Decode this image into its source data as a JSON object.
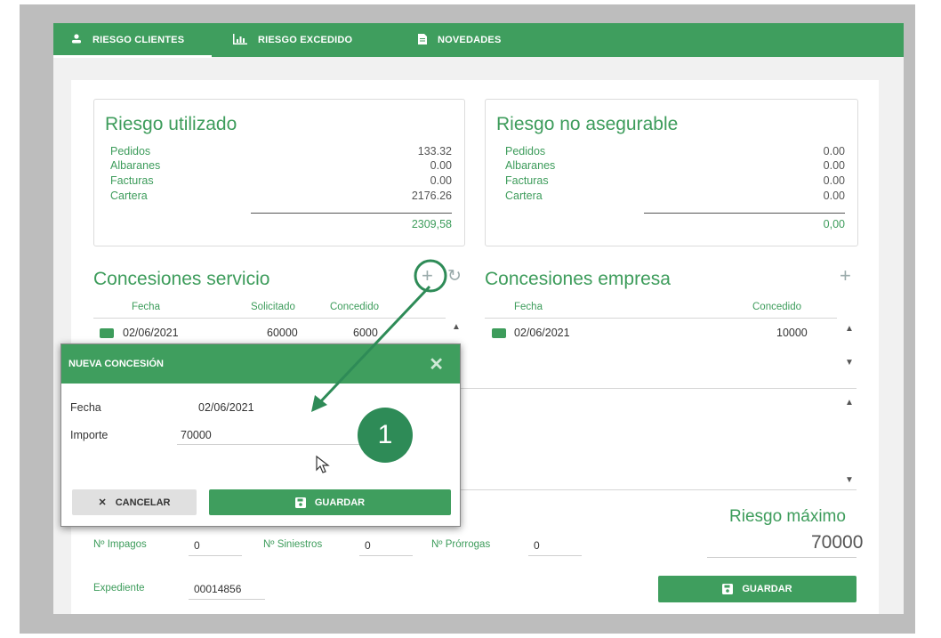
{
  "tabs": [
    {
      "label": "RIESGO CLIENTES",
      "icon": "user-icon",
      "active": true
    },
    {
      "label": "RIESGO EXCEDIDO",
      "icon": "bar-chart-icon",
      "active": false
    },
    {
      "label": "NOVEDADES",
      "icon": "document-icon",
      "active": false
    }
  ],
  "riesgo_utilizado": {
    "title": "Riesgo utilizado",
    "rows": [
      {
        "label": "Pedidos",
        "value": "133.32"
      },
      {
        "label": "Albaranes",
        "value": "0.00"
      },
      {
        "label": "Facturas",
        "value": "0.00"
      },
      {
        "label": "Cartera",
        "value": "2176.26"
      }
    ],
    "total": "2309,58"
  },
  "riesgo_no_asegurable": {
    "title": "Riesgo no asegurable",
    "rows": [
      {
        "label": "Pedidos",
        "value": "0.00"
      },
      {
        "label": "Albaranes",
        "value": "0.00"
      },
      {
        "label": "Facturas",
        "value": "0.00"
      },
      {
        "label": "Cartera",
        "value": "0.00"
      }
    ],
    "total": "0,00"
  },
  "concesiones_servicio": {
    "title": "Concesiones servicio",
    "headers": {
      "fecha": "Fecha",
      "solicitado": "Solicitado",
      "concedido": "Concedido"
    },
    "row": {
      "fecha": "02/06/2021",
      "solicitado": "60000",
      "concedido": "6000"
    },
    "add_symbol": "+",
    "refresh_symbol": "↻"
  },
  "concesiones_empresa": {
    "title": "Concesiones empresa",
    "headers": {
      "fecha": "Fecha",
      "concedido": "Concedido"
    },
    "row": {
      "fecha": "02/06/2021",
      "concedido": "10000"
    },
    "add_symbol": "+"
  },
  "scroll": {
    "up": "▲",
    "down": "▼"
  },
  "riesgo_maximo": {
    "label": "Riesgo máximo",
    "value": "70000"
  },
  "counters": {
    "impagos_label": "Nº Impagos",
    "impagos_value": "0",
    "siniestros_label": "Nº Siniestros",
    "siniestros_value": "0",
    "prorrogas_label": "Nº Prórrogas",
    "prorrogas_value": "0"
  },
  "expediente": {
    "label": "Expediente",
    "value": "00014856"
  },
  "guardar_label": "GUARDAR",
  "modal": {
    "title": "NUEVA CONCESIÓN",
    "close_symbol": "✕",
    "fecha_label": "Fecha",
    "fecha_value": "02/06/2021",
    "importe_label": "Importe",
    "importe_value": "70000",
    "cancel_label": "CANCELAR",
    "cancel_symbol": "✕",
    "save_label": "GUARDAR"
  },
  "callout_number": "1",
  "colors": {
    "primary": "#3f9e5e",
    "text_green": "#3d9c5b",
    "badge": "#2e8b57"
  }
}
